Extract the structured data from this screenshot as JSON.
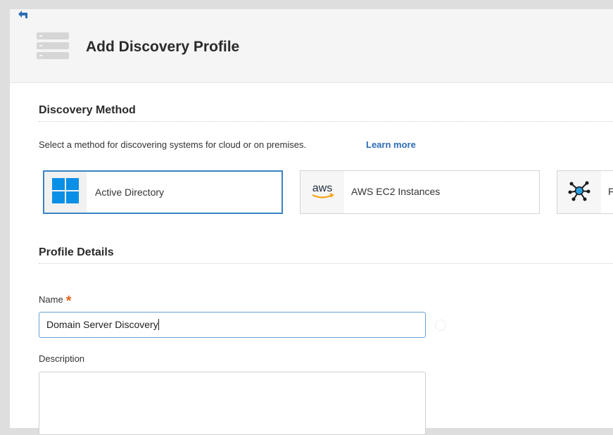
{
  "header": {
    "title": "Add Discovery Profile",
    "back_icon": "back-arrow-icon",
    "page_icon": "server-stack-icon"
  },
  "discovery_method": {
    "title": "Discovery Method",
    "description": "Select a method for discovering systems for cloud or on premises.",
    "learn_more": "Learn more",
    "methods": [
      {
        "label": "Active Directory",
        "icon": "windows-logo-icon",
        "selected": true
      },
      {
        "label": "AWS EC2 Instances",
        "icon": "aws-logo-icon",
        "selected": false
      },
      {
        "label": "F",
        "icon": "network-hub-icon",
        "selected": false
      }
    ]
  },
  "profile_details": {
    "title": "Profile Details",
    "name_label": "Name",
    "required_mark": "*",
    "name_value": "Domain Server Discovery",
    "description_label": "Description",
    "description_value": ""
  },
  "colors": {
    "accent": "#3b82c4",
    "link": "#2d6cb5",
    "required": "#e6651b",
    "windows_blue": "#0a8fe6",
    "aws_orange": "#f7a51c"
  }
}
